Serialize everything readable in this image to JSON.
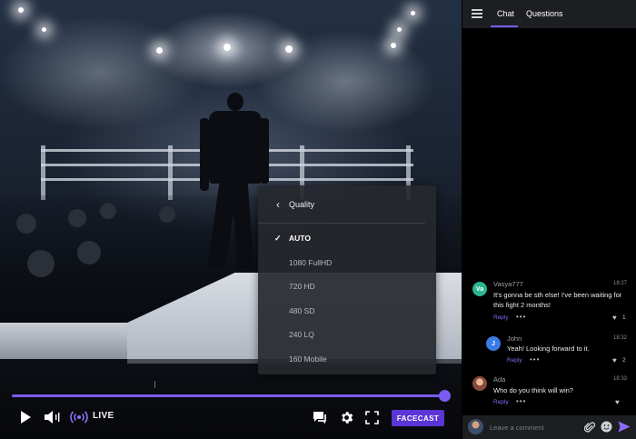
{
  "quality_menu": {
    "title": "Quality",
    "options": [
      {
        "label": "AUTO",
        "selected": true
      },
      {
        "label": "1080 FullHD",
        "selected": false
      },
      {
        "label": "720 HD",
        "selected": false
      },
      {
        "label": "480 SD",
        "selected": false
      },
      {
        "label": "240 LQ",
        "selected": false
      },
      {
        "label": "160 Mobile",
        "selected": false
      }
    ]
  },
  "player": {
    "live_label": "LIVE",
    "cta_label": "FACECAST",
    "progress": 1.0,
    "accent_color": "#7a5bf0",
    "icons": [
      "play-icon",
      "volume-icon",
      "live-broadcast-icon",
      "chat-toggle-icon",
      "gear-icon",
      "fullscreen-icon"
    ]
  },
  "chat": {
    "tabs": [
      {
        "label": "Chat",
        "active": true
      },
      {
        "label": "Questions",
        "active": false
      }
    ],
    "comments": [
      {
        "initials": "Va",
        "avatar_color": "#2bb58e",
        "name": "Vasya777",
        "time": "18:27",
        "text_lines": [
          "It's gonna be sth else! I've been waiting for",
          "this fight 2 months!"
        ],
        "reply": "Reply",
        "likes": "1"
      },
      {
        "initials": "J",
        "avatar_color": "#3a7be6",
        "name": "John",
        "time": "18:32",
        "text_lines": [
          "Yeah! Looking forward to it."
        ],
        "reply": "Reply",
        "likes": "2"
      },
      {
        "initials": "",
        "avatar_color": "#c98b6b",
        "name": "Ada",
        "time": "18:33",
        "text_lines": [
          "Who do you think will win?"
        ],
        "reply": "Reply",
        "likes": ""
      }
    ],
    "input": {
      "placeholder": "Leave a comment"
    }
  }
}
